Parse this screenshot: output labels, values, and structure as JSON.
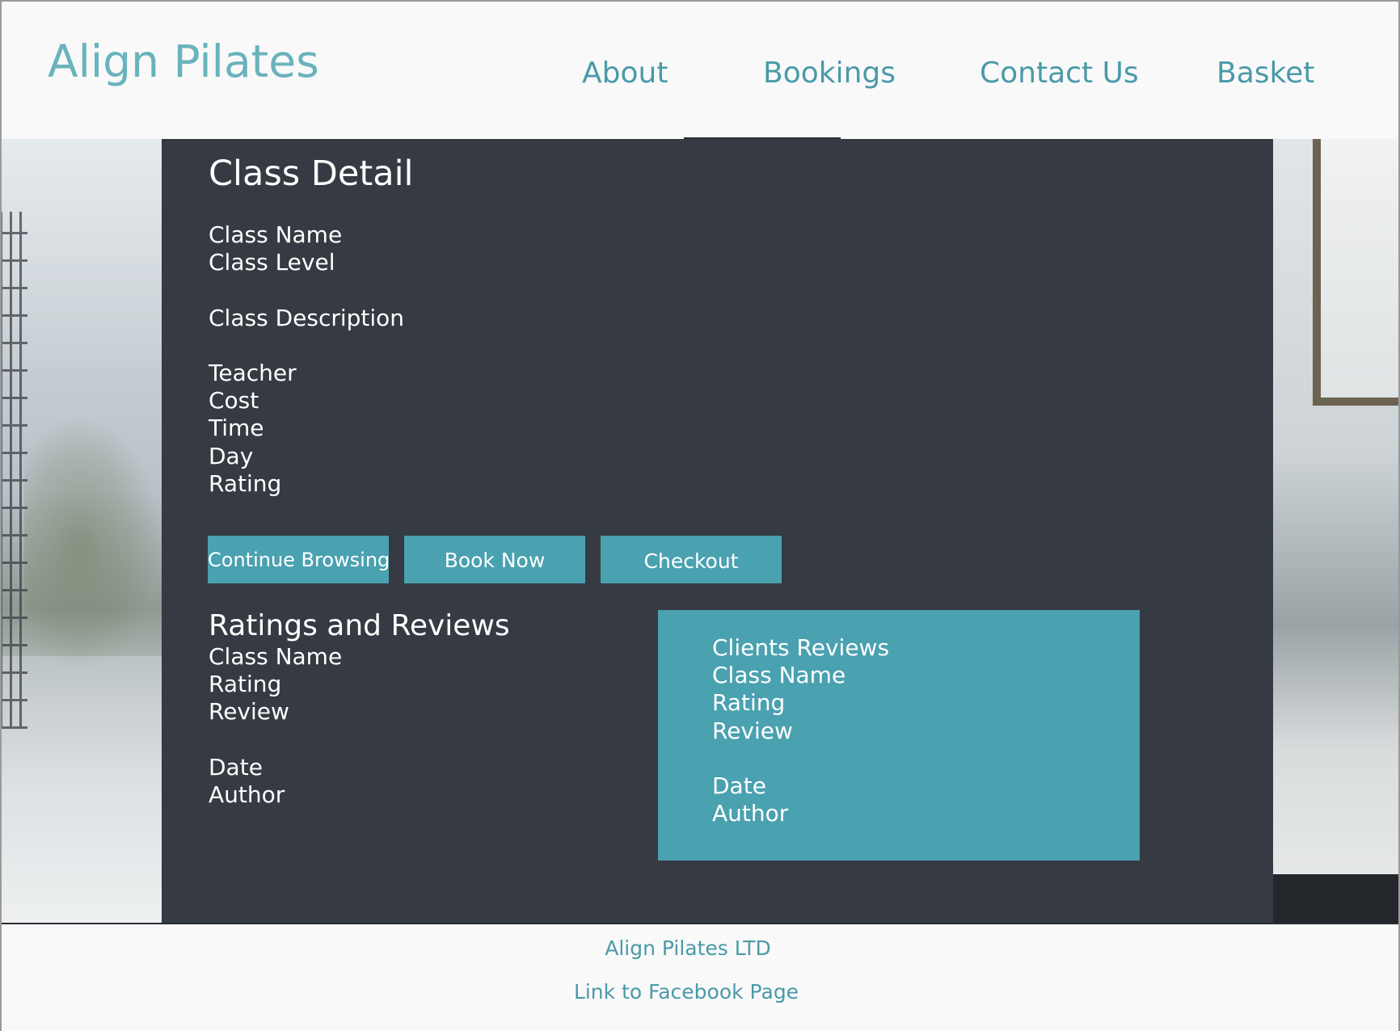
{
  "header": {
    "logo": "Align Pilates",
    "nav": {
      "about": "About",
      "bookings": "Bookings",
      "contact": "Contact Us",
      "basket": "Basket"
    },
    "active_nav": "Bookings"
  },
  "class_detail": {
    "title": "Class Detail",
    "fields": {
      "class_name": "Class Name",
      "class_level": "Class Level",
      "class_description": "Class Description",
      "teacher": "Teacher",
      "cost": "Cost",
      "time": "Time",
      "day": "Day",
      "rating": "Rating"
    },
    "buttons": {
      "continue_browsing": "Continue Browsing",
      "book_now": "Book Now",
      "checkout": "Checkout"
    }
  },
  "ratings_reviews": {
    "heading": "Ratings and Reviews",
    "class_name": "Class Name",
    "rating": "Rating",
    "review": "Review",
    "date": "Date",
    "author": "Author"
  },
  "clients_reviews": {
    "heading": "Clients Reviews",
    "class_name": "Class Name",
    "rating": "Rating",
    "review": "Review",
    "date": "Date",
    "author": "Author"
  },
  "footer": {
    "company": "Align Pilates LTD",
    "facebook_link": "Link to Facebook Page"
  },
  "colors": {
    "accent_teal": "#4aa1b0",
    "logo_teal": "#69b3bd",
    "panel_dark": "#363a42",
    "page_background": "#f9f9f9"
  }
}
